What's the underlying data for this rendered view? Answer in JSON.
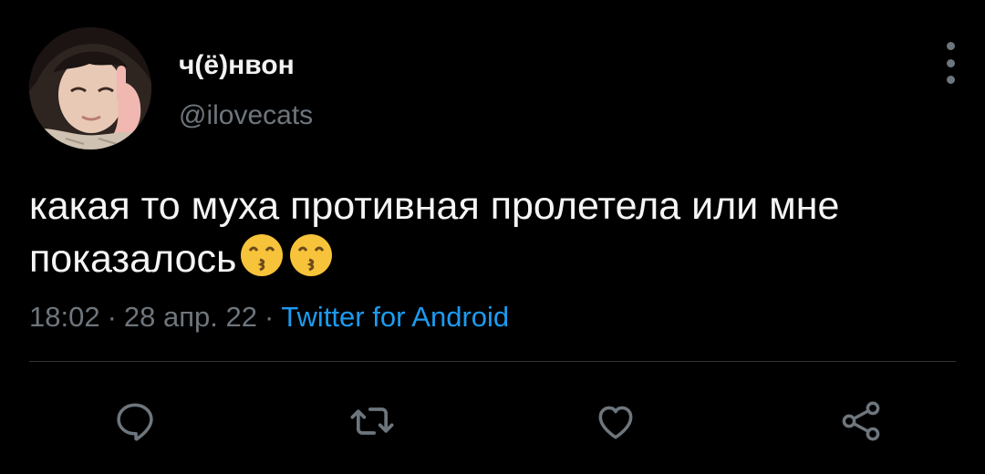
{
  "tweet": {
    "author": {
      "display_name": "ч(ё)нвон",
      "handle": "@ilovecats"
    },
    "text": "какая то муха противная пролетела или мне показалось",
    "emoji": [
      "😙",
      "😙"
    ],
    "meta": {
      "time": "18:02",
      "separator": "·",
      "date": "28 апр. 22",
      "source": "Twitter for Android"
    },
    "actions": [
      {
        "icon": "reply-icon"
      },
      {
        "icon": "retweet-icon"
      },
      {
        "icon": "like-icon"
      },
      {
        "icon": "share-icon"
      }
    ]
  },
  "colors": {
    "background": "#000000",
    "text_primary": "#f5f5f5",
    "text_secondary": "#6e767d",
    "accent": "#1d9bf0",
    "divider": "#2f3336"
  }
}
